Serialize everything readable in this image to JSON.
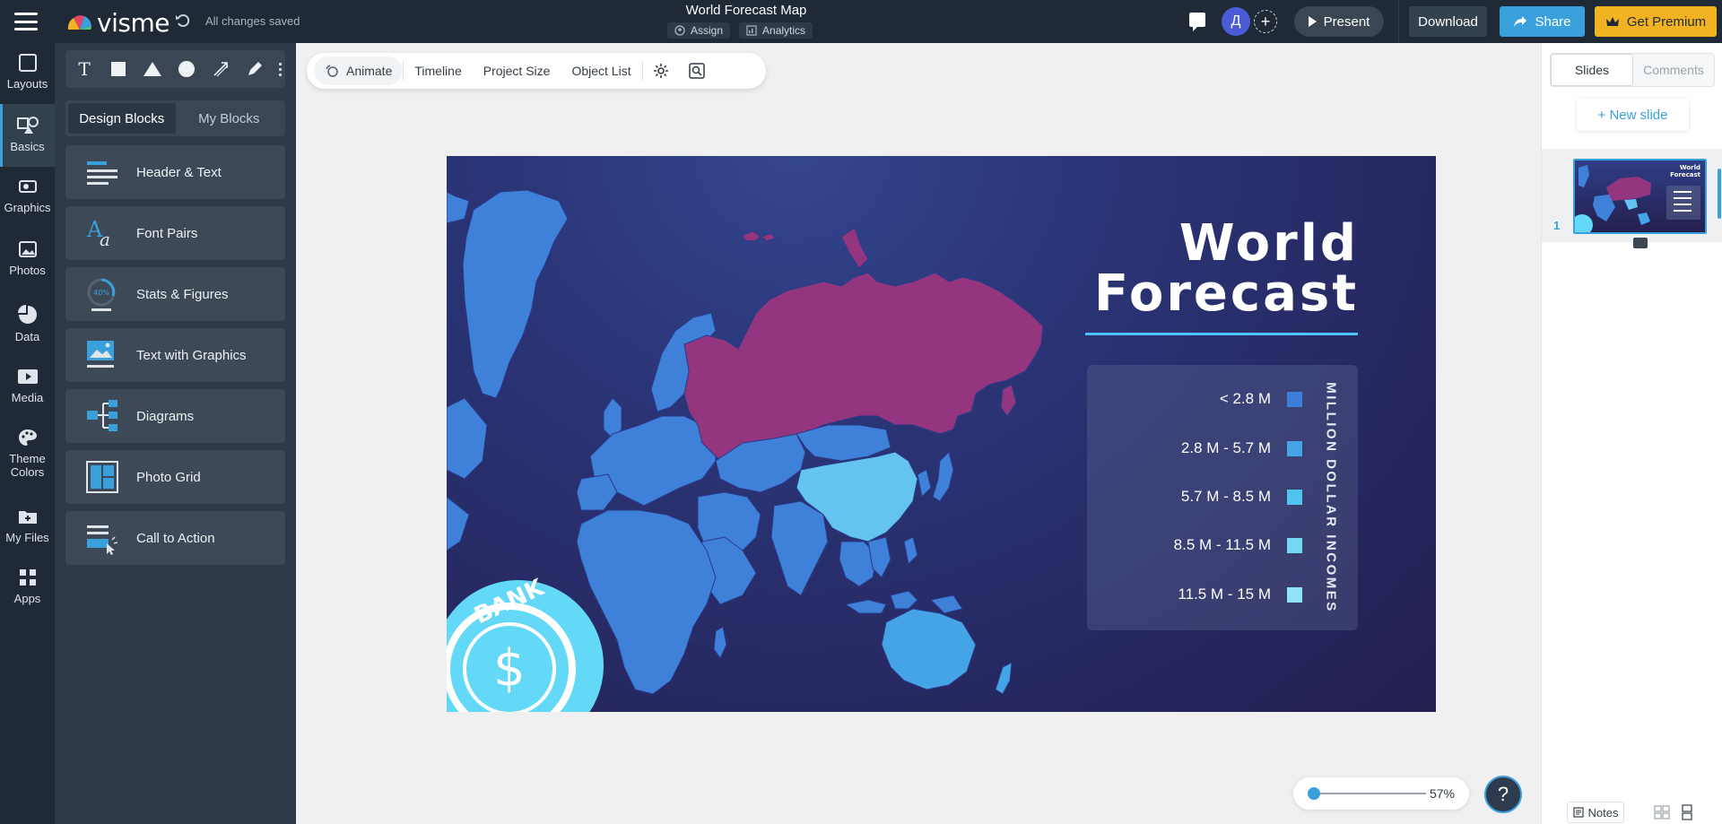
{
  "app": {
    "logo_text": "visme",
    "save_status": "All changes saved"
  },
  "project": {
    "title": "World Forecast Map",
    "assign_label": "Assign",
    "analytics_label": "Analytics"
  },
  "header": {
    "avatar_initial": "Д",
    "present_label": "Present",
    "download_label": "Download",
    "share_label": "Share",
    "premium_label": "Get Premium"
  },
  "rail": {
    "items": [
      {
        "label": "Layouts"
      },
      {
        "label": "Basics"
      },
      {
        "label": "Graphics"
      },
      {
        "label": "Photos"
      },
      {
        "label": "Data"
      },
      {
        "label": "Media"
      },
      {
        "label": "Theme Colors"
      },
      {
        "label": "My Files"
      },
      {
        "label": "Apps"
      }
    ],
    "active": "Basics"
  },
  "panel": {
    "tabs": [
      "Design Blocks",
      "My Blocks"
    ],
    "active_tab": "Design Blocks",
    "blocks": [
      {
        "label": "Header & Text"
      },
      {
        "label": "Font Pairs"
      },
      {
        "label": "Stats & Figures"
      },
      {
        "label": "Text with Graphics"
      },
      {
        "label": "Diagrams"
      },
      {
        "label": "Photo Grid"
      },
      {
        "label": "Call to Action"
      }
    ],
    "stats_icon_text": "40%"
  },
  "context_bar": {
    "animate_label": "Animate",
    "timeline_label": "Timeline",
    "project_size_label": "Project Size",
    "object_list_label": "Object List"
  },
  "slide": {
    "title_line1": "World",
    "title_line2": "Forecast",
    "legend_title": "MILLION DOLLAR INCOMES",
    "legend": [
      {
        "label": "< 2.8 M",
        "color": "#3d7fd8"
      },
      {
        "label": "2.8 M - 5.7 M",
        "color": "#45a4e6"
      },
      {
        "label": "5.7 M - 8.5 M",
        "color": "#4ec4ef"
      },
      {
        "label": "8.5 M - 11.5 M",
        "color": "#74d7f4"
      },
      {
        "label": "11.5 M - 15 M",
        "color": "#8fe3f8"
      }
    ],
    "badge_text": "BANK",
    "badge_symbol": "$",
    "colors": {
      "russia": "#93357f",
      "base": "#3f80d9",
      "china": "#64c4ef",
      "bank": "#63d8f7"
    }
  },
  "right_panel": {
    "tabs": [
      "Slides",
      "Comments"
    ],
    "active_tab": "Slides",
    "new_slide_label": "+ New slide",
    "slide_number": "1",
    "notes_label": "Notes"
  },
  "zoom": {
    "label": "57%",
    "value": 57
  },
  "help": {
    "label": "?"
  }
}
